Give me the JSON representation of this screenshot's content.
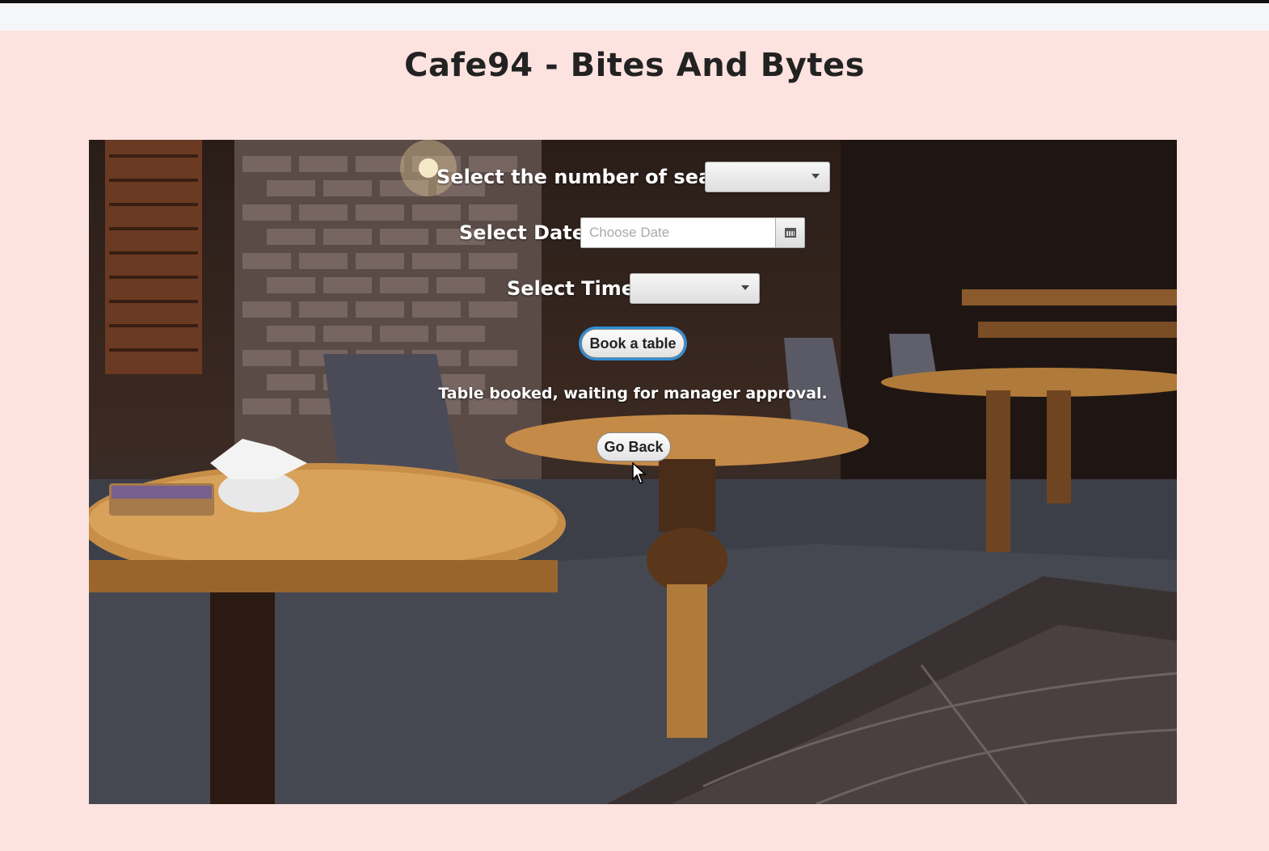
{
  "app": {
    "title": "Cafe94 - Bites And Bytes"
  },
  "form": {
    "seats_label": "Select the number of seats:",
    "seats_value": "",
    "date_label": "Select Date:",
    "date_placeholder": "Choose Date",
    "time_label": "Select Time:",
    "time_value": "",
    "book_button": "Book a table",
    "status_message": "Table booked, waiting for manager approval.",
    "back_button": "Go Back"
  },
  "icons": {
    "dropdown": "chevron-down-icon",
    "calendar": "calendar-icon",
    "cursor": "mouse-pointer-icon"
  },
  "colors": {
    "page_background": "#fde3df",
    "focus_ring": "#2f8fd8",
    "label_text": "#ffffff"
  }
}
